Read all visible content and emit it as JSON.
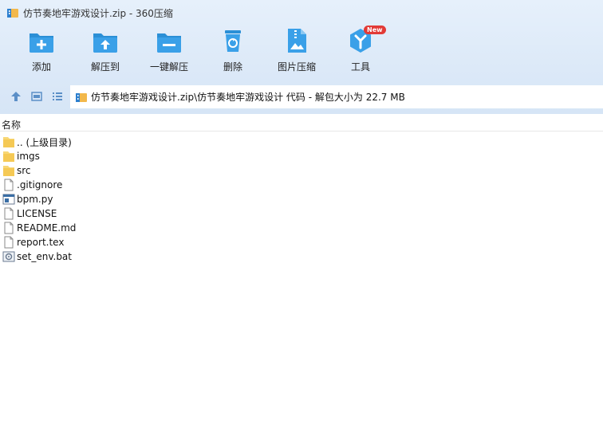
{
  "window": {
    "title": "仿节奏地牢游戏设计.zip - 360压缩"
  },
  "toolbar": {
    "add_label": "添加",
    "extract_to_label": "解压到",
    "one_click_extract_label": "一键解压",
    "delete_label": "删除",
    "image_compress_label": "图片压缩",
    "tools_label": "工具",
    "tools_badge": "New"
  },
  "address": {
    "path": "仿节奏地牢游戏设计.zip\\仿节奏地牢游戏设计 代码 - 解包大小为 22.7 MB"
  },
  "columns": {
    "name": "名称"
  },
  "files": [
    {
      "name": ".. (上级目录)",
      "icon": "folder-icon"
    },
    {
      "name": "imgs",
      "icon": "folder-icon"
    },
    {
      "name": "src",
      "icon": "folder-icon"
    },
    {
      "name": ".gitignore",
      "icon": "file-icon"
    },
    {
      "name": "bpm.py",
      "icon": "python-file-icon"
    },
    {
      "name": "LICENSE",
      "icon": "file-icon"
    },
    {
      "name": "README.md",
      "icon": "file-icon"
    },
    {
      "name": "report.tex",
      "icon": "file-icon"
    },
    {
      "name": "set_env.bat",
      "icon": "batch-file-icon"
    }
  ],
  "colors": {
    "accent": "#2b8fd6",
    "toolbar_bg": "#dce9f8",
    "badge": "#e23a36"
  }
}
